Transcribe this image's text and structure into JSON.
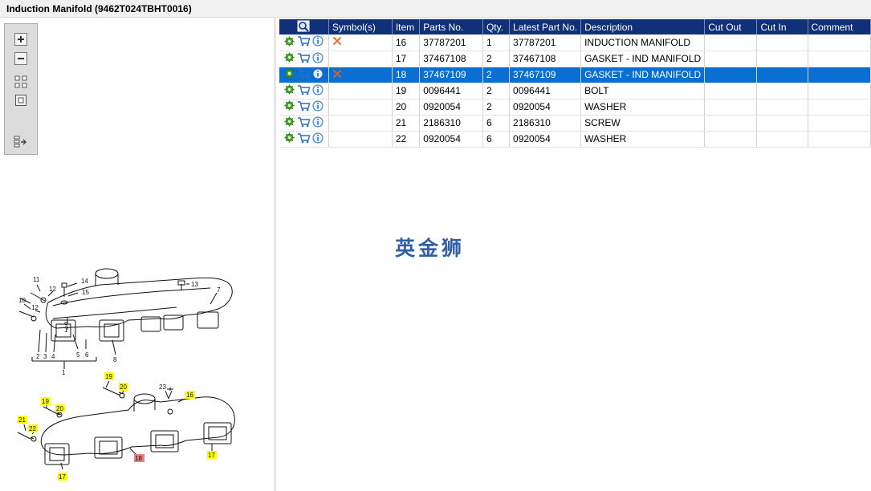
{
  "window": {
    "title": "Induction Manifold (9462T024TBHT0016)"
  },
  "toolbar": {
    "buttons": [
      {
        "name": "zoom-in-button",
        "icon": "plus-icon"
      },
      {
        "name": "zoom-out-button",
        "icon": "minus-icon"
      },
      {
        "name": "fit-all-button",
        "icon": "grid-icon"
      },
      {
        "name": "fit-window-button",
        "icon": "square-icon"
      },
      {
        "name": "export-button",
        "icon": "export-icon"
      }
    ]
  },
  "table": {
    "columns": [
      "",
      "Symbol(s)",
      "Item",
      "Parts No.",
      "Qty.",
      "Latest Part No.",
      "Description",
      "Cut Out",
      "Cut In",
      "Comment"
    ],
    "rows": [
      {
        "symbol": "x",
        "item": "16",
        "part_no": "37787201",
        "qty": "1",
        "latest": "37787201",
        "description": "INDUCTION MANIFOLD",
        "cut_out": "",
        "cut_in": "",
        "comment": "",
        "selected": false
      },
      {
        "symbol": "",
        "item": "17",
        "part_no": "37467108",
        "qty": "2",
        "latest": "37467108",
        "description": "GASKET - IND MANIFOLD",
        "cut_out": "",
        "cut_in": "",
        "comment": "",
        "selected": false
      },
      {
        "symbol": "x",
        "item": "18",
        "part_no": "37467109",
        "qty": "2",
        "latest": "37467109",
        "description": "GASKET - IND MANIFOLD",
        "cut_out": "",
        "cut_in": "",
        "comment": "",
        "selected": true
      },
      {
        "symbol": "",
        "item": "19",
        "part_no": "0096441",
        "qty": "2",
        "latest": "0096441",
        "description": "BOLT",
        "cut_out": "",
        "cut_in": "",
        "comment": "",
        "selected": false
      },
      {
        "symbol": "",
        "item": "20",
        "part_no": "0920054",
        "qty": "2",
        "latest": "0920054",
        "description": "WASHER",
        "cut_out": "",
        "cut_in": "",
        "comment": "",
        "selected": false
      },
      {
        "symbol": "",
        "item": "21",
        "part_no": "2186310",
        "qty": "6",
        "latest": "2186310",
        "description": "SCREW",
        "cut_out": "",
        "cut_in": "",
        "comment": "",
        "selected": false
      },
      {
        "symbol": "",
        "item": "22",
        "part_no": "0920054",
        "qty": "6",
        "latest": "0920054",
        "description": "WASHER",
        "cut_out": "",
        "cut_in": "",
        "comment": "",
        "selected": false
      }
    ]
  },
  "watermark": "英金狮",
  "diagram": {
    "upper_labels": [
      "11",
      "12",
      "14",
      "15",
      "13",
      "7",
      "10",
      "12",
      "9",
      "1",
      "2",
      "3",
      "4",
      "5",
      "6",
      "8",
      "1"
    ],
    "lower_labels": [
      "19",
      "20",
      "23",
      "16",
      "19",
      "20",
      "21",
      "22",
      "18",
      "17",
      "17"
    ]
  },
  "colors": {
    "header_bg": "#10307a",
    "selected_row": "#0a6fd2",
    "callout_highlight": "#ffff00",
    "callout_selected": "#f08080",
    "symbol_x": "#e8601c"
  }
}
